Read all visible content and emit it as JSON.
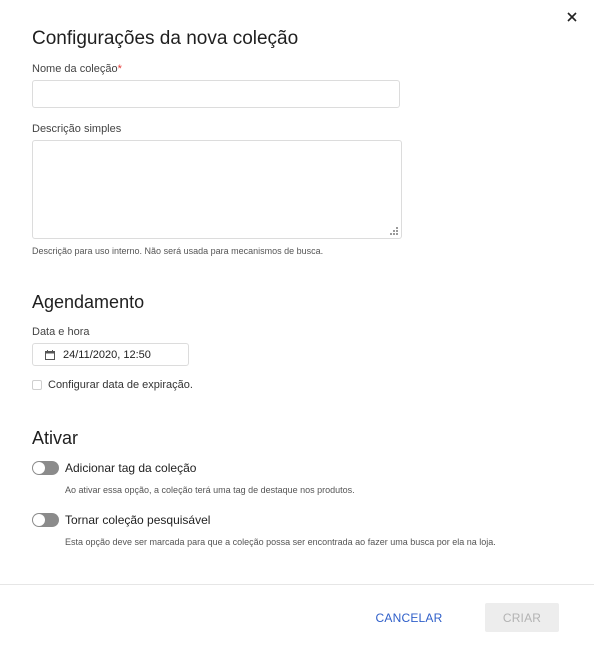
{
  "modal": {
    "title": "Configurações da nova coleção",
    "close_icon": "close-icon"
  },
  "collection_name": {
    "label": "Nome da coleção",
    "required_mark": "*",
    "value": "",
    "placeholder": ""
  },
  "description": {
    "label": "Descrição simples",
    "value": "",
    "hint": "Descrição para uso interno. Não será usada para mecanismos de busca."
  },
  "scheduling": {
    "title": "Agendamento",
    "date_label": "Data e hora",
    "date_value": "24/11/2020, 12:50",
    "calendar_icon": "calendar-icon",
    "expiration_checkbox_label": "Configurar data de expiração.",
    "expiration_checked": false
  },
  "activate": {
    "title": "Ativar",
    "toggles": [
      {
        "label": "Adicionar tag da coleção",
        "hint": "Ao ativar essa opção, a coleção terá uma tag de destaque nos produtos.",
        "on": false
      },
      {
        "label": "Tornar coleção pesquisável",
        "hint": "Esta opção deve ser marcada para que a coleção possa ser encontrada ao fazer uma busca por ela na loja.",
        "on": false
      }
    ]
  },
  "footer": {
    "cancel_label": "CANCELAR",
    "create_label": "CRIAR",
    "create_disabled": true
  },
  "colors": {
    "accent": "#2f5fc9",
    "required": "#e53935",
    "toggle_off": "#8b8b8b",
    "disabled_bg": "#ededed",
    "disabled_text": "#b3b3b3"
  }
}
